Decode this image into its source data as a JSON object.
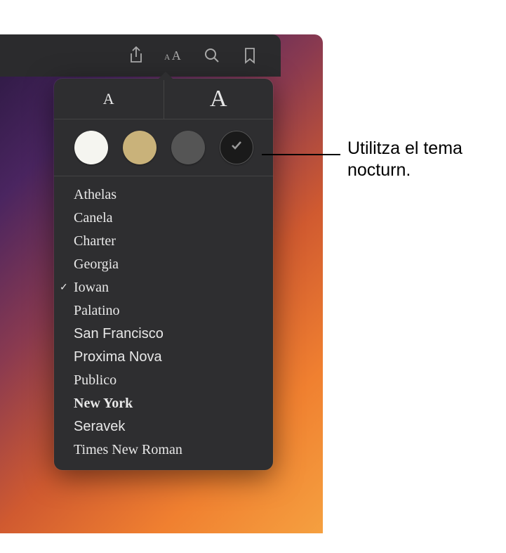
{
  "toolbar": {
    "share": "share-icon",
    "appearance": "text-size-icon",
    "search": "search-icon",
    "bookmark": "bookmark-icon"
  },
  "popover": {
    "size_small_label": "A",
    "size_large_label": "A",
    "themes": {
      "white": "#f5f5f0",
      "sepia": "#c9b27a",
      "gray": "#555555",
      "night": "#1a1a1a",
      "selected": "night"
    },
    "fonts": [
      {
        "label": "Athelas",
        "class": "f-athelas",
        "selected": false
      },
      {
        "label": "Canela",
        "class": "f-canela",
        "selected": false
      },
      {
        "label": "Charter",
        "class": "f-charter",
        "selected": false
      },
      {
        "label": "Georgia",
        "class": "f-georgia",
        "selected": false
      },
      {
        "label": "Iowan",
        "class": "f-iowan",
        "selected": true
      },
      {
        "label": "Palatino",
        "class": "f-palatino",
        "selected": false
      },
      {
        "label": "San Francisco",
        "class": "f-sf",
        "selected": false
      },
      {
        "label": "Proxima Nova",
        "class": "f-proxima",
        "selected": false
      },
      {
        "label": "Publico",
        "class": "f-publico",
        "selected": false
      },
      {
        "label": "New York",
        "class": "f-newyork",
        "selected": false
      },
      {
        "label": "Seravek",
        "class": "f-seravek",
        "selected": false
      },
      {
        "label": "Times New Roman",
        "class": "f-times",
        "selected": false
      }
    ]
  },
  "callout": {
    "text": "Utilitza el tema nocturn."
  }
}
